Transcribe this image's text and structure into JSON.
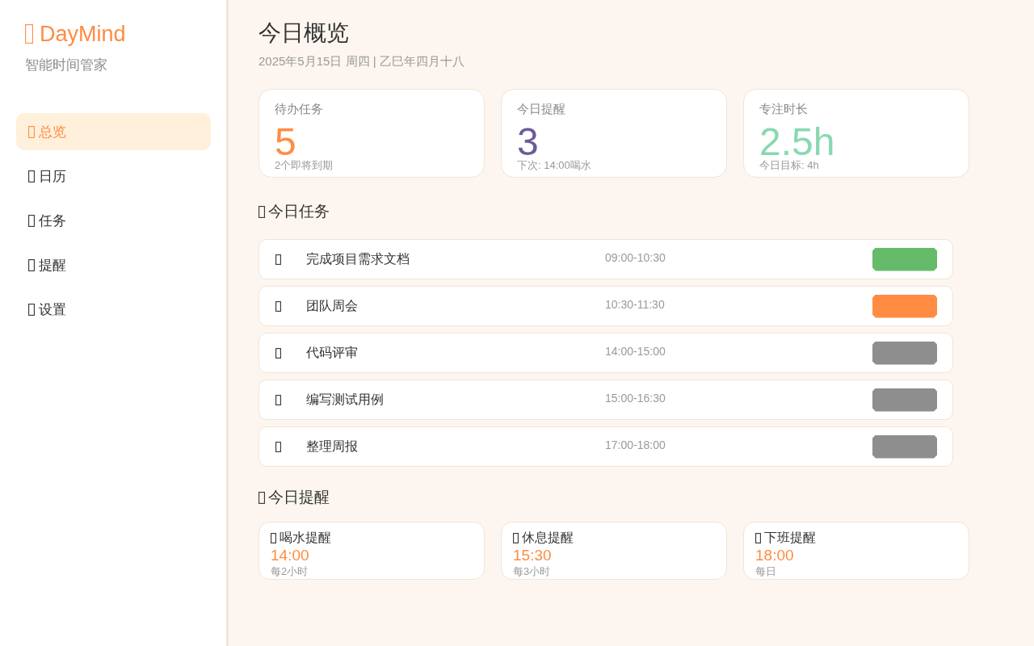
{
  "sidebar": {
    "logo": "DayMind",
    "tagline": "智能时间管家",
    "nav": [
      {
        "label": "总览",
        "selected": true
      },
      {
        "label": "日历",
        "selected": false
      },
      {
        "label": "任务",
        "selected": false
      },
      {
        "label": "提醒",
        "selected": false
      },
      {
        "label": "设置",
        "selected": false
      }
    ]
  },
  "header": {
    "title": "今日概览",
    "date": "2025年5月15日 周四 | 乙巳年四月十八"
  },
  "stats": [
    {
      "label": "待办任务",
      "value": "5",
      "note": "2个即将到期",
      "color": "#ff8c42"
    },
    {
      "label": "今日提醒",
      "value": "3",
      "note": "下次: 14:00喝水",
      "color": "#6b5b95"
    },
    {
      "label": "专注时长",
      "value": "2.5h",
      "note": "今日目标: 4h",
      "color": "#88d8b0"
    }
  ],
  "tasks": {
    "heading": "今日任务",
    "items": [
      {
        "name": "完成项目需求文档",
        "time": "09:00-10:30",
        "color": "#66bb6a"
      },
      {
        "name": "团队周会",
        "time": "10:30-11:30",
        "color": "#ff8c42"
      },
      {
        "name": "代码评审",
        "time": "14:00-15:00",
        "color": "#8e8e8e"
      },
      {
        "name": "编写测试用例",
        "time": "15:00-16:30",
        "color": "#8e8e8e"
      },
      {
        "name": "整理周报",
        "time": "17:00-18:00",
        "color": "#8e8e8e"
      }
    ]
  },
  "reminders": {
    "heading": "今日提醒",
    "items": [
      {
        "title": "喝水提醒",
        "time": "14:00",
        "repeat": "每2小时"
      },
      {
        "title": "休息提醒",
        "time": "15:30",
        "repeat": "每3小时"
      },
      {
        "title": "下班提醒",
        "time": "18:00",
        "repeat": "每日"
      }
    ]
  }
}
